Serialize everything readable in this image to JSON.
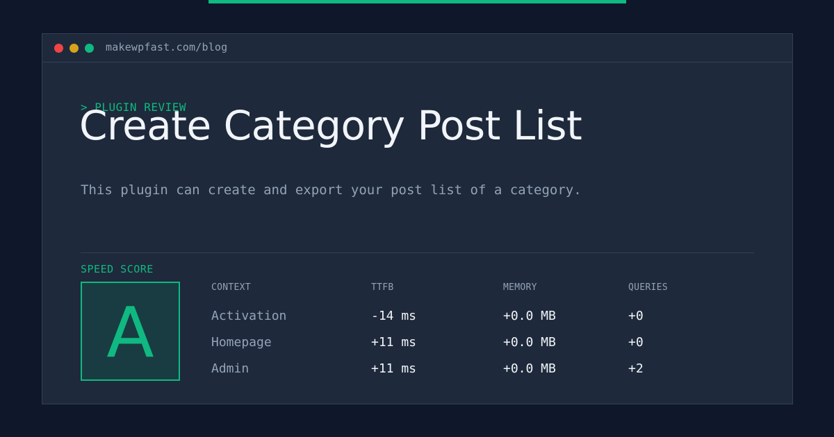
{
  "window": {
    "url": "makewpfast.com/blog"
  },
  "hero": {
    "eyebrow": "> PLUGIN REVIEW",
    "title": "Create Category Post List",
    "description": "This plugin can create and export your post list of a category."
  },
  "score": {
    "label": "SPEED SCORE",
    "grade": "A"
  },
  "metrics": {
    "columns": [
      "CONTEXT",
      "TTFB",
      "MEMORY",
      "QUERIES"
    ],
    "rows": [
      [
        "Activation",
        "-14 ms",
        "+0.0 MB",
        "+0"
      ],
      [
        "Homepage",
        "+11 ms",
        "+0.0 MB",
        "+0"
      ],
      [
        "Admin",
        "+11 ms",
        "+0.0 MB",
        "+2"
      ]
    ]
  },
  "colors": {
    "accent": "#10b981",
    "background": "#0f172a",
    "panel": "#1e293b"
  }
}
